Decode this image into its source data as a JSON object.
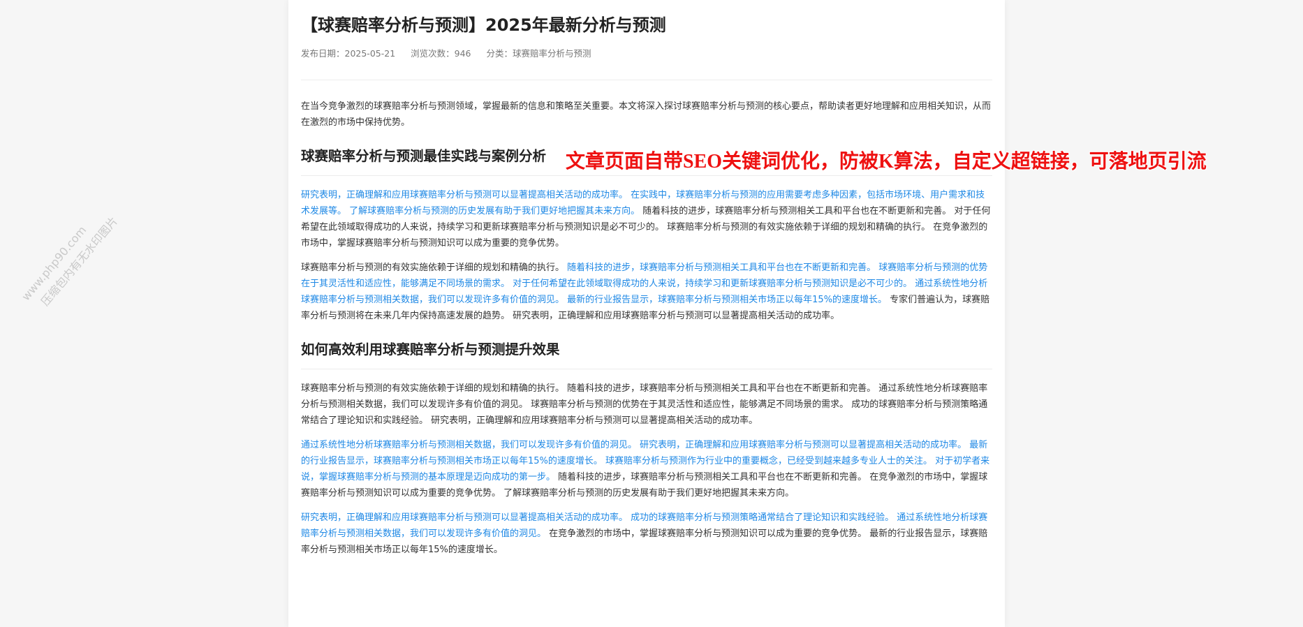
{
  "article": {
    "title": "【球赛赔率分析与预测】2025年最新分析与预测",
    "meta": {
      "date": "发布日期：2025-05-21",
      "views": "浏览次数：946",
      "category": "分类：球赛赔率分析与预测"
    },
    "intro": "在当今竞争激烈的球赛赔率分析与预测领域，掌握最新的信息和策略至关重要。本文将深入探讨球赛赔率分析与预测的核心要点，帮助读者更好地理解和应用相关知识，从而在激烈的市场中保持优势。",
    "section1_heading": "球赛赔率分析与预测最佳实践与案例分析",
    "section1_paragraphs": [
      [
        {
          "t": "研究表明，正确理解和应用球赛赔率分析与预测可以显著提高相关活动的成功率。",
          "link": true
        },
        {
          "t": " 在实践中，球赛赔率分析与预测的应用需要考虑多种因素，包括市场环境、用户需求和技术发展等。",
          "link": true
        },
        {
          "t": " 了解球赛赔率分析与预测的历史发展有助于我们更好地把握其未来方向。",
          "link": true
        },
        {
          "t": " 随着科技的进步，球赛赔率分析与预测相关工具和平台也在不断更新和完善。",
          "link": false
        },
        {
          "t": " 对于任何希望在此领域取得成功的人来说，持续学习和更新球赛赔率分析与预测知识是必不可少的。",
          "link": false
        },
        {
          "t": " 球赛赔率分析与预测的有效实施依赖于详细的规划和精确的执行。",
          "link": false
        },
        {
          "t": " 在竞争激烈的市场中，掌握球赛赔率分析与预测知识可以成为重要的竞争优势。",
          "link": false
        }
      ],
      [
        {
          "t": "球赛赔率分析与预测的有效实施依赖于详细的规划和精确的执行。",
          "link": false
        },
        {
          "t": " 随着科技的进步，球赛赔率分析与预测相关工具和平台也在不断更新和完善。",
          "link": true
        },
        {
          "t": " 球赛赔率分析与预测的优势在于其灵活性和适应性，能够满足不同场景的需求。",
          "link": true
        },
        {
          "t": " 对于任何希望在此领域取得成功的人来说，持续学习和更新球赛赔率分析与预测知识是必不可少的。",
          "link": true
        },
        {
          "t": " 通过系统性地分析球赛赔率分析与预测相关数据，我们可以发现许多有价值的洞见。",
          "link": true
        },
        {
          "t": " 最新的行业报告显示，球赛赔率分析与预测相关市场正以每年15%的速度增长。",
          "link": true
        },
        {
          "t": " 专家们普遍认为，球赛赔率分析与预测将在未来几年内保持高速发展的趋势。",
          "link": false
        },
        {
          "t": " 研究表明，正确理解和应用球赛赔率分析与预测可以显著提高相关活动的成功率。",
          "link": false
        }
      ]
    ],
    "section2_heading": "如何高效利用球赛赔率分析与预测提升效果",
    "section2_paragraphs": [
      [
        {
          "t": "球赛赔率分析与预测的有效实施依赖于详细的规划和精确的执行。",
          "link": false
        },
        {
          "t": " 随着科技的进步，球赛赔率分析与预测相关工具和平台也在不断更新和完善。",
          "link": false
        },
        {
          "t": " 通过系统性地分析球赛赔率分析与预测相关数据，我们可以发现许多有价值的洞见。",
          "link": false
        },
        {
          "t": " 球赛赔率分析与预测的优势在于其灵活性和适应性，能够满足不同场景的需求。",
          "link": false
        },
        {
          "t": " 成功的球赛赔率分析与预测策略通常结合了理论知识和实践经验。",
          "link": false
        },
        {
          "t": " 研究表明，正确理解和应用球赛赔率分析与预测可以显著提高相关活动的成功率。",
          "link": false
        }
      ],
      [
        {
          "t": "通过系统性地分析球赛赔率分析与预测相关数据，我们可以发现许多有价值的洞见。",
          "link": true
        },
        {
          "t": " 研究表明，正确理解和应用球赛赔率分析与预测可以显著提高相关活动的成功率。",
          "link": true
        },
        {
          "t": " 最新的行业报告显示，球赛赔率分析与预测相关市场正以每年15%的速度增长。",
          "link": true
        },
        {
          "t": " 球赛赔率分析与预测作为行业中的重要概念，已经受到越来越多专业人士的关注。",
          "link": true
        },
        {
          "t": " 对于初学者来说，掌握球赛赔率分析与预测的基本原理是迈向成功的第一步。",
          "link": true
        },
        {
          "t": " 随着科技的进步，球赛赔率分析与预测相关工具和平台也在不断更新和完善。",
          "link": false
        },
        {
          "t": " 在竞争激烈的市场中，掌握球赛赔率分析与预测知识可以成为重要的竞争优势。",
          "link": false
        },
        {
          "t": " 了解球赛赔率分析与预测的历史发展有助于我们更好地把握其未来方向。",
          "link": false
        }
      ],
      [
        {
          "t": "研究表明，正确理解和应用球赛赔率分析与预测可以显著提高相关活动的成功率。",
          "link": true
        },
        {
          "t": " 成功的球赛赔率分析与预测策略通常结合了理论知识和实践经验。",
          "link": true
        },
        {
          "t": " 通过系统性地分析球赛赔率分析与预测相关数据，我们可以发现许多有价值的洞见。",
          "link": true
        },
        {
          "t": " 在竞争激烈的市场中，掌握球赛赔率分析与预测知识可以成为重要的竞争优势。",
          "link": false
        },
        {
          "t": " 最新的行业报告显示，球赛赔率分析与预测相关市场正以每年15%的速度增长。",
          "link": false
        }
      ]
    ]
  },
  "overlay": {
    "banner": "文章页面自带SEO关键词优化，防被K算法，自定义超链接，可落地页引流",
    "watermark_line1": "www.php90.com",
    "watermark_line2": "压缩包内有无水印图片"
  },
  "colors": {
    "link": "#1e88e5",
    "text": "#333333",
    "banner": "#ee1111"
  }
}
